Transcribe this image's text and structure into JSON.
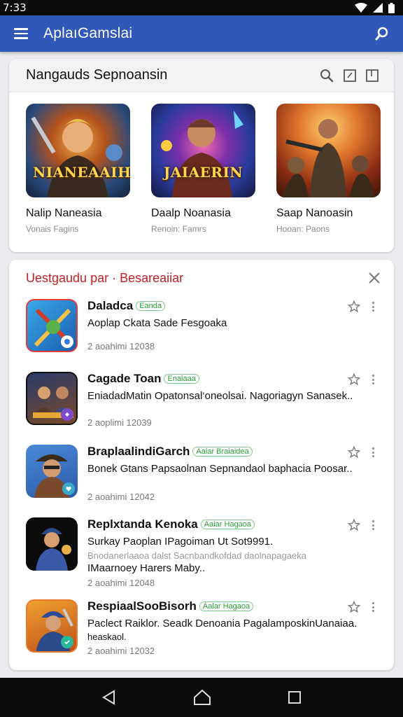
{
  "status_bar": {
    "time": "7:33"
  },
  "app_bar": {
    "title": "AplaıGamslai",
    "menu_icon": "hamburger-icon",
    "search_icon": "search-icon"
  },
  "featured": {
    "title": "Nangauds  Sepnoansin",
    "games": [
      {
        "art_text": "NIANEAAIH",
        "name": "Nalip Naneasia",
        "subtitle": "Vonais Fagins"
      },
      {
        "art_text": "JAIAERIN",
        "name": "Daalp Noanasia",
        "subtitle": "Renoin: Famrs"
      },
      {
        "art_text": "",
        "name": "Saap Nanoasin",
        "subtitle": "Hooan: Paons"
      }
    ]
  },
  "list": {
    "title": "Uestgaudu par · Besareaiiar",
    "items": [
      {
        "name": "Daladca",
        "tag": "Eanda",
        "description": "Aoplap Ckata Sade Fesgoaka",
        "date": "2 aoahimi 12038"
      },
      {
        "name": "Cagade Toan",
        "tag": "Enaiaaa",
        "description": "EniadadMatin Opatonsal‘oneolsai. Nagoriagyn Sanasek..",
        "date": "2 aoplimi 12039"
      },
      {
        "name": "BraplaalindiGarch",
        "tag": "Aaiar Braiaidea",
        "description": "Bonek Gtans Papsaolnan Sepnandaol baphacia Poosar..",
        "date": "2 aoahimi 12042"
      },
      {
        "name": "Replxtanda Kenoka",
        "tag": "Aaiar Hagaoa",
        "description": "Surkay Paoplan IPagoiman Ut Sot9991.",
        "description2": "Bnodanerlaaoa dalst Sacnbandkofdad  daolnapagaeka",
        "description3": "IMaarnoey Harers Maby..",
        "date": "2 aoahimi 12048"
      },
      {
        "name": "RespiaalSooBisorh",
        "tag": "Aalar Hagaoa",
        "description": "Paclect Raiklor. Seadk Denoania PagalamposkinUanaiaa.",
        "description3": "heaskaol.",
        "date": "2 aoahimi 12032"
      }
    ]
  },
  "nav_bar": {
    "back_icon": "back-triangle-icon",
    "home_icon": "home-icon",
    "recents_icon": "recents-square-icon"
  }
}
